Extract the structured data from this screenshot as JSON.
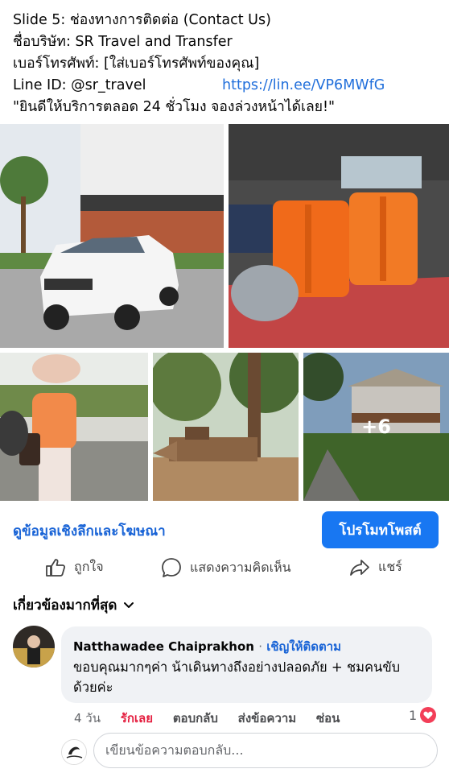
{
  "post": {
    "line1": "Slide 5: ช่องทางการติดต่อ (Contact Us)",
    "line2": "ชื่อบริษัท: SR Travel and Transfer",
    "line3": "เบอร์โทรศัพท์: [ใส่เบอร์โทรศัพท์ของคุณ]",
    "line_id_label": "Line ID:  @sr_travel",
    "line_link": "https://lin.ee/VP6MWfG",
    "line5": "\"ยินดีให้บริการตลอด 24 ชั่วโมง จองล่วงหน้าได้เลย!\""
  },
  "photos": {
    "more_count": "+6"
  },
  "insights_link": "ดูข้อมูลเชิงลึกและโฆษณา",
  "promote_button": "โปรโมทโพสต์",
  "actions": {
    "like": "ถูกใจ",
    "comment": "แสดงความคิดเห็น",
    "share": "แชร์"
  },
  "comments_filter": "เกี่ยวข้องมากที่สุด",
  "comment": {
    "author": "Natthawadee Chaiprakhon",
    "separator": "·",
    "follow": "เชิญให้ติดตาม",
    "text": "ขอบคุณมากๆค่า น้าเดินทางถึงอย่างปลอดภัย + ชมคนขับด้วยค่ะ",
    "time": "4 วัน",
    "loved": "รักเลย",
    "reply": "ตอบกลับ",
    "send_message": "ส่งข้อความ",
    "hide": "ซ่อน",
    "reaction_count": "1"
  },
  "reply_input": {
    "placeholder": "เขียนข้อความตอบกลับ..."
  },
  "colors": {
    "accent": "#1877f2",
    "link": "#216fdb",
    "love": "#e41e3f"
  }
}
